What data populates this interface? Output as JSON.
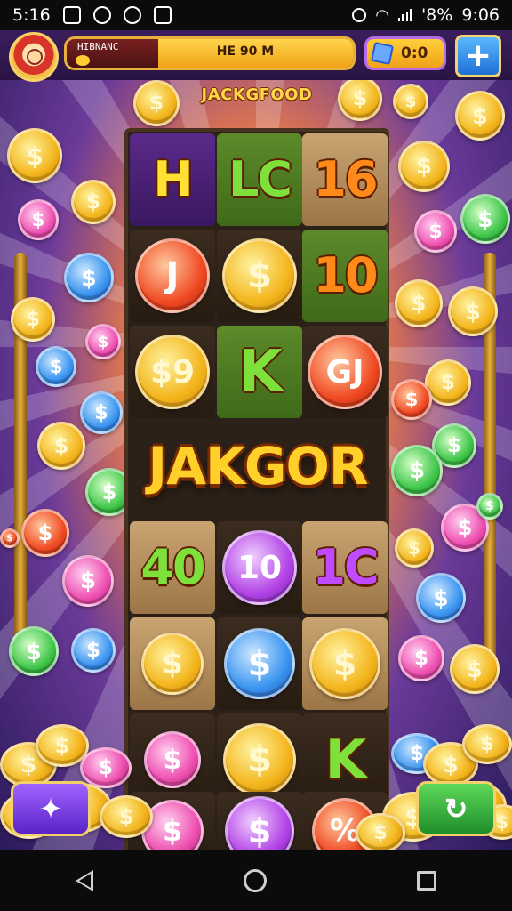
{
  "status_bar": {
    "time": "5:16",
    "battery": "'8%",
    "clock": "9:06"
  },
  "hud": {
    "player_name": "HIBNANC",
    "progress_text": "HE 90 M",
    "progress_fraction": 0.68,
    "gem_count": "0:0",
    "add_label": "+"
  },
  "title": "JACKGFOOD",
  "banner": "JAKGOR",
  "reels": {
    "row1": [
      "H",
      "LC",
      "16"
    ],
    "row2": [
      "J",
      "$",
      "10"
    ],
    "row3": [
      "$9",
      "K",
      "GJ"
    ],
    "row5": [
      "40",
      "10",
      "1C"
    ],
    "row6": [
      "$",
      "$",
      "$"
    ],
    "row7": [
      "$",
      "$",
      "K"
    ],
    "row8": [
      "$",
      "$",
      "%"
    ]
  },
  "coin_symbol": "$",
  "colors": {
    "gold": "#f3b51c",
    "pink": "#ee4fb0",
    "blue": "#3a94f0",
    "green": "#3fc64a",
    "red": "#f04a22",
    "purple": "#b344e6"
  },
  "buttons": {
    "left_icon": "wand-icon",
    "right_icon": "spin-icon"
  }
}
